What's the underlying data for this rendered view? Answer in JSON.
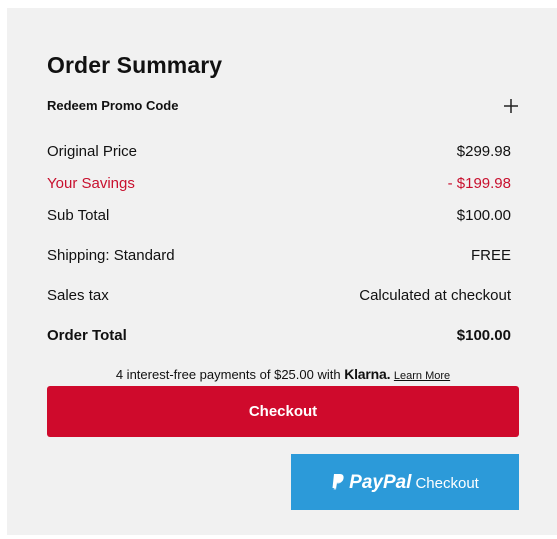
{
  "summary": {
    "title": "Order Summary",
    "promo_label": "Redeem Promo Code"
  },
  "rows": {
    "original_price": {
      "label": "Original Price",
      "value": "$299.98"
    },
    "savings": {
      "label": "Your Savings",
      "value": "- $199.98"
    },
    "sub_total": {
      "label": "Sub Total",
      "value": "$100.00"
    },
    "shipping": {
      "label": "Shipping: Standard",
      "value": "FREE"
    },
    "sales_tax": {
      "label": "Sales tax",
      "value": "Calculated at checkout"
    },
    "order_total": {
      "label": "Order Total",
      "value": "$100.00"
    }
  },
  "klarna": {
    "text": "4 interest-free payments of $25.00 with",
    "brand": "Klarna.",
    "learn_more": "Learn More"
  },
  "buttons": {
    "checkout": "Checkout",
    "paypal_brand": "PayPal",
    "paypal_checkout": "Checkout"
  },
  "colors": {
    "panel_bg": "#f1f1f1",
    "savings": "#c8102e",
    "checkout_bg": "#cf0a2c",
    "paypal_bg": "#2c9ad9"
  },
  "icons": {
    "expand": "plus-icon",
    "paypal": "paypal-p-icon"
  }
}
